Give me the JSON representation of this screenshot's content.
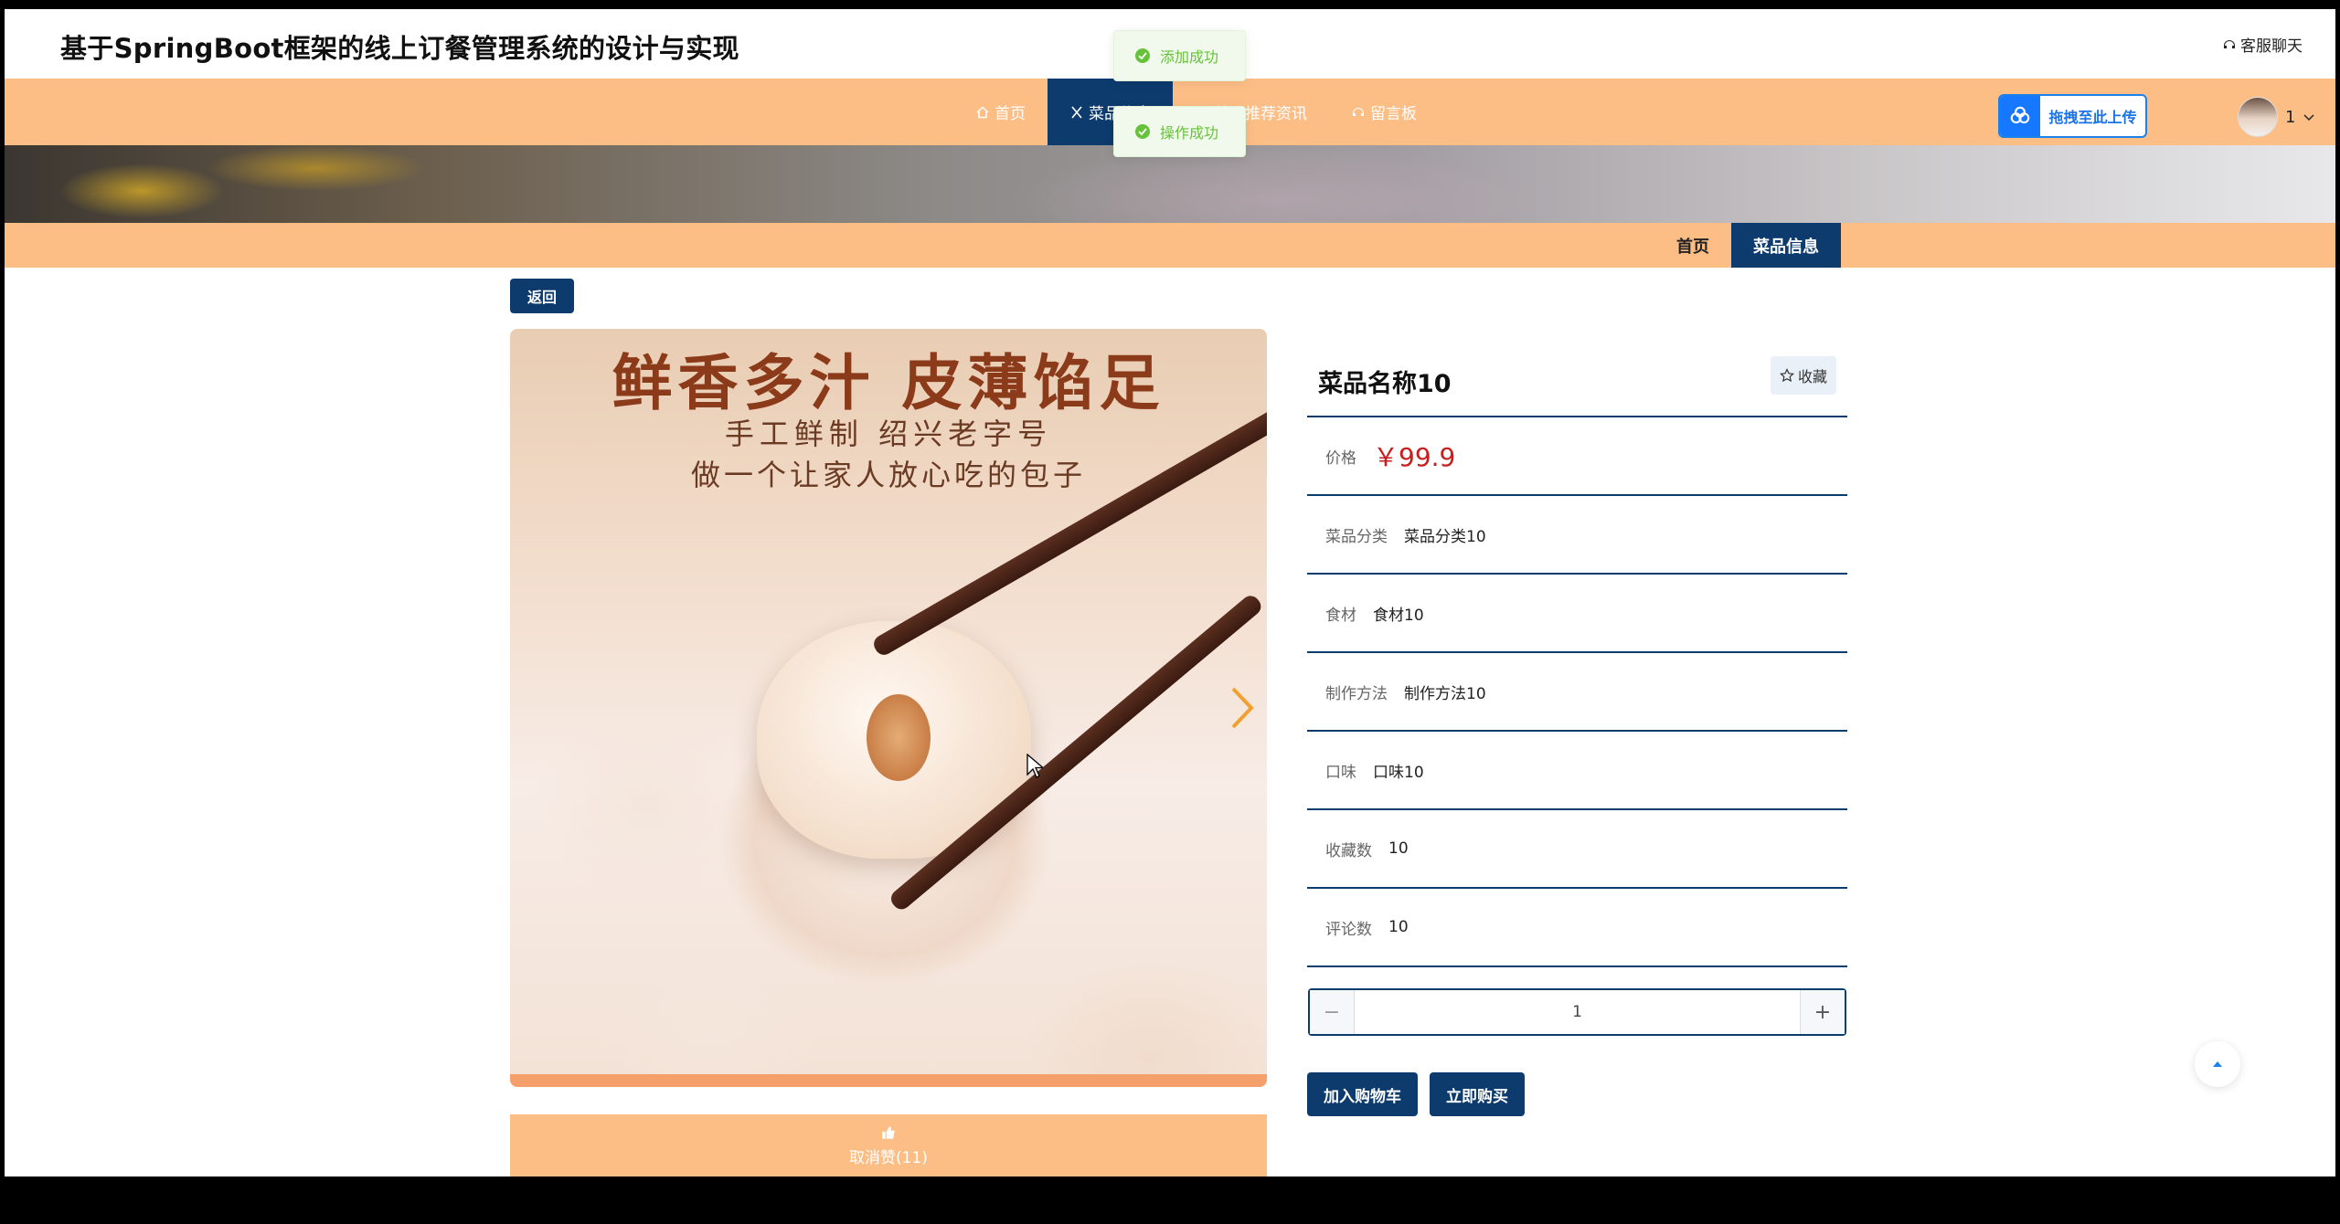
{
  "header": {
    "site_title": "基于SpringBoot框架的线上订餐管理系统的设计与实现",
    "customer_service": "客服聊天"
  },
  "nav": {
    "items": [
      {
        "label": "首页",
        "icon": "home-icon",
        "active": false
      },
      {
        "label": "菜品信息",
        "icon": "utensils-icon",
        "active": true
      },
      {
        "label": "美食推荐资讯",
        "icon": "news-icon",
        "active": false
      },
      {
        "label": "留言板",
        "icon": "message-icon",
        "active": false
      }
    ]
  },
  "upload": {
    "label": "拖拽至此上传"
  },
  "user": {
    "name": "1"
  },
  "breadcrumb": {
    "items": [
      "首页",
      "菜品信息"
    ]
  },
  "back_label": "返回",
  "product_image_text": {
    "line1": "鲜香多汁 皮薄馅足",
    "line2": "手工鲜制 绍兴老字号",
    "line3": "做一个让家人放心吃的包子"
  },
  "like": {
    "label": "取消赞(11)"
  },
  "dish": {
    "name": "菜品名称10",
    "favorite_label": "收藏",
    "price_label": "价格",
    "price": "￥99.9",
    "fields": [
      {
        "label": "菜品分类",
        "value": "菜品分类10"
      },
      {
        "label": "食材",
        "value": "食材10"
      },
      {
        "label": "制作方法",
        "value": "制作方法10"
      },
      {
        "label": "口味",
        "value": "口味10"
      },
      {
        "label": "收藏数",
        "value": "10"
      },
      {
        "label": "评论数",
        "value": "10"
      }
    ]
  },
  "quantity": {
    "minus": "−",
    "value": "1",
    "plus": "+"
  },
  "actions": {
    "add_to_cart": "加入购物车",
    "buy_now": "立即购买"
  },
  "toasts": [
    "添加成功",
    "操作成功"
  ],
  "colors": {
    "accent_orange": "#FDBE86",
    "navy": "#0D3B6E",
    "price_red": "#C81E1E",
    "success_green": "#67C23A"
  }
}
